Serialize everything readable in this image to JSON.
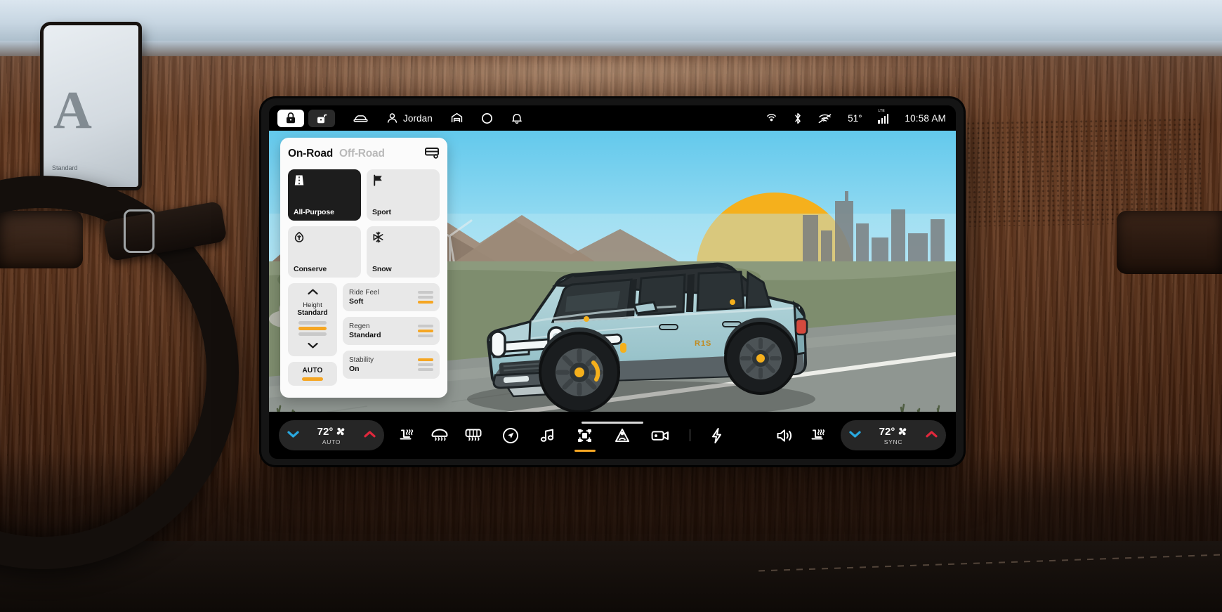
{
  "status_bar": {
    "left_items": [
      {
        "name": "lock-button",
        "icon": "lock-icon",
        "state": "active"
      },
      {
        "name": "unlock-button",
        "icon": "unlock-icon",
        "state": "inactive"
      },
      {
        "name": "vehicle-button",
        "icon": "car-icon",
        "state": "inactive"
      },
      {
        "name": "profile-button",
        "icon": "person-icon",
        "label": "Jordan"
      },
      {
        "name": "garage-button",
        "icon": "garage-icon",
        "state": "inactive"
      },
      {
        "name": "rivian-logo",
        "icon": "circle-logo-icon",
        "state": "inactive"
      },
      {
        "name": "notifications-button",
        "icon": "bell-icon",
        "state": "inactive"
      }
    ],
    "profile_name": "Jordan",
    "right_items": [
      {
        "name": "hotspot-icon",
        "icon": "hotspot-icon"
      },
      {
        "name": "bluetooth-icon",
        "icon": "bluetooth-icon"
      },
      {
        "name": "wifi-off-icon",
        "icon": "wifi-off-icon"
      }
    ],
    "temperature": "51°",
    "cellular": {
      "label": "LTE",
      "bars": 4
    },
    "time": "10:58 AM"
  },
  "drive_panel": {
    "tabs": [
      {
        "label": "On-Road",
        "active": true
      },
      {
        "label": "Off-Road",
        "active": false
      }
    ],
    "tab_on_road": "On-Road",
    "tab_off_road": "Off-Road",
    "trailer_icon": "trailer-icon",
    "modes": [
      {
        "label": "All-Purpose",
        "icon": "road-icon",
        "selected": true
      },
      {
        "label": "Sport",
        "icon": "flag-icon",
        "selected": false
      },
      {
        "label": "Conserve",
        "icon": "leaf-icon",
        "selected": false
      },
      {
        "label": "Snow",
        "icon": "snowflake-icon",
        "selected": false
      }
    ],
    "height": {
      "title": "Height",
      "value": "Standard",
      "up_icon": "chevron-up-icon",
      "down_icon": "chevron-down-icon",
      "segments": [
        false,
        true,
        false
      ],
      "auto_label": "AUTO",
      "auto_on": true
    },
    "options": [
      {
        "name": "Ride Feel",
        "value": "Soft",
        "segments": [
          false,
          false,
          true
        ]
      },
      {
        "name": "Regen",
        "value": "Standard",
        "segments": [
          false,
          true,
          false
        ]
      },
      {
        "name": "Stability",
        "value": "On",
        "segments": [
          true,
          false,
          false
        ]
      }
    ]
  },
  "toolbar": {
    "left_climate": {
      "temp": "72°",
      "sub": "AUTO",
      "fan_icon": "fan-icon",
      "down_icon": "chevron-down-icon",
      "up_icon": "chevron-up-icon"
    },
    "left_buttons": [
      {
        "name": "driver-seat-heater-button",
        "icon": "seat-heater-icon"
      },
      {
        "name": "front-defrost-button",
        "icon": "front-defrost-icon"
      },
      {
        "name": "rear-defrost-button",
        "icon": "rear-defrost-icon"
      }
    ],
    "center_buttons": [
      {
        "name": "navigation-button",
        "icon": "navigation-icon",
        "active": false
      },
      {
        "name": "media-button",
        "icon": "music-note-icon",
        "active": false
      },
      {
        "name": "drive-modes-button",
        "icon": "chassis-icon",
        "active": true
      },
      {
        "name": "driver-assist-button",
        "icon": "driver-assist-icon",
        "active": false
      },
      {
        "name": "camera-button",
        "icon": "camera-icon",
        "active": false
      },
      {
        "name": "divider",
        "icon": "divider",
        "active": false
      },
      {
        "name": "charging-button",
        "icon": "bolt-icon",
        "active": false
      }
    ],
    "right_buttons": [
      {
        "name": "volume-button",
        "icon": "speaker-icon"
      },
      {
        "name": "passenger-seat-heater-button",
        "icon": "seat-heater-icon"
      }
    ],
    "right_climate": {
      "temp": "72°",
      "sub": "SYNC",
      "fan_icon": "fan-icon",
      "down_icon": "chevron-down-icon",
      "up_icon": "chevron-up-icon"
    }
  },
  "scene": {
    "description": "Rivian R1S SUV on a road at sunset",
    "sky_color": "#7fd3ef",
    "sun_color": "#f5b01c",
    "vehicle_color": "#a8cdd3",
    "road_color": "#8f9691",
    "grass_color": "#7d8a6e"
  },
  "colors": {
    "accent_orange": "#f5a623",
    "accent_blue": "#29a9e0",
    "accent_red": "#e0283c",
    "panel_bg": "#fbfbfb",
    "card_bg": "#e8e8e8",
    "card_selected": "#1d1d1d"
  },
  "cluster": {
    "glyph": "A",
    "label": "Standard"
  }
}
